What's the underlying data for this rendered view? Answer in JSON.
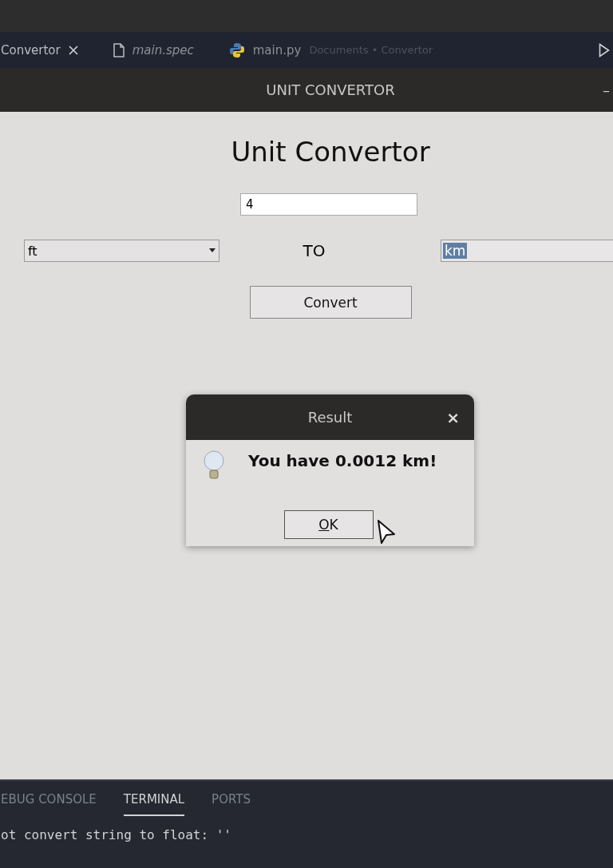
{
  "editor_tabs": [
    {
      "label": "Convertor",
      "kind": "closable",
      "selected": true
    },
    {
      "label": "main.spec",
      "kind": "file",
      "selected": false
    },
    {
      "label": "main.py",
      "kind": "python",
      "selected": false,
      "breadcrumb": "Documents • Convertor"
    }
  ],
  "window": {
    "title": "UNIT CONVERTOR",
    "minimize": "–"
  },
  "app": {
    "heading": "Unit Convertor",
    "amount": "4",
    "from_unit": "ft",
    "to_label": "TO",
    "to_unit": "km",
    "to_unit_selected": true,
    "convert_button": "Convert"
  },
  "dialog": {
    "title": "Result",
    "close": "×",
    "message": "You have 0.0012 km!",
    "ok_button": "OK"
  },
  "panel_tabs": [
    {
      "label": "EBUG CONSOLE",
      "selected": false
    },
    {
      "label": "TERMINAL",
      "selected": true
    },
    {
      "label": "PORTS",
      "selected": false
    }
  ],
  "terminal_line": "ot convert string to float: ''"
}
